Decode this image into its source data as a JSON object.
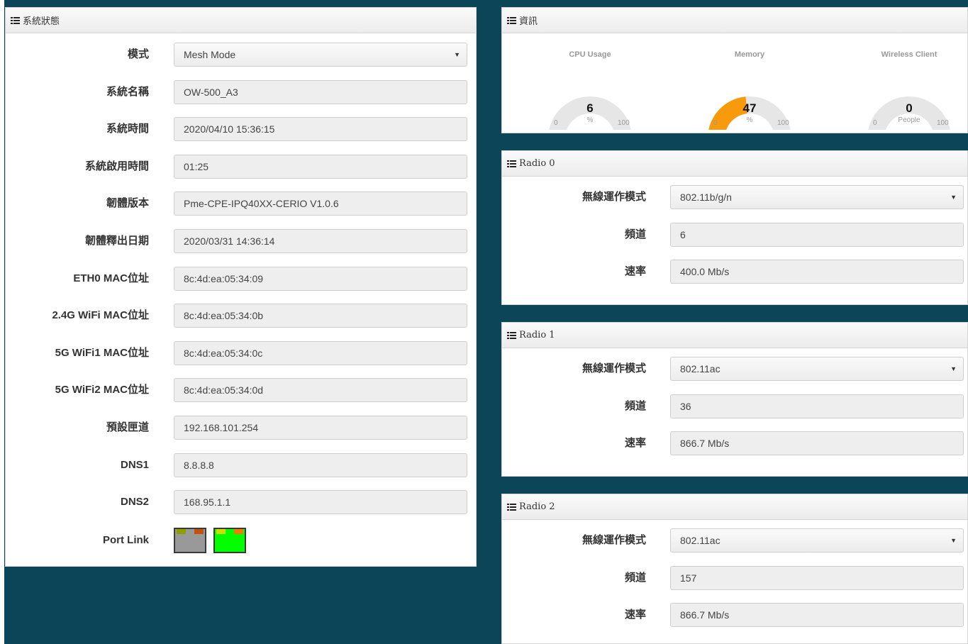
{
  "system": {
    "title": "系統狀態",
    "rows": [
      {
        "label": "模式",
        "value": "Mesh Mode",
        "type": "select"
      },
      {
        "label": "系統名稱",
        "value": "OW-500_A3",
        "type": "text"
      },
      {
        "label": "系統時間",
        "value": "2020/04/10 15:36:15",
        "type": "text"
      },
      {
        "label": "系統啟用時間",
        "value": "01:25",
        "type": "text"
      },
      {
        "label": "韌體版本",
        "value": "Pme-CPE-IPQ40XX-CERIO V1.0.6",
        "type": "text"
      },
      {
        "label": "韌體釋出日期",
        "value": "2020/03/31 14:36:14",
        "type": "text"
      },
      {
        "label": "ETH0 MAC位址",
        "value": "8c:4d:ea:05:34:09",
        "type": "text"
      },
      {
        "label": "2.4G WiFi MAC位址",
        "value": "8c:4d:ea:05:34:0b",
        "type": "text"
      },
      {
        "label": "5G WiFi1 MAC位址",
        "value": "8c:4d:ea:05:34:0c",
        "type": "text"
      },
      {
        "label": "5G WiFi2 MAC位址",
        "value": "8c:4d:ea:05:34:0d",
        "type": "text"
      },
      {
        "label": "預設匣道",
        "value": "192.168.101.254",
        "type": "text"
      },
      {
        "label": "DNS1",
        "value": "8.8.8.8",
        "type": "text"
      },
      {
        "label": "DNS2",
        "value": "168.95.1.1",
        "type": "text"
      }
    ],
    "port_link_label": "Port Link",
    "ports": [
      {
        "status": "inactive",
        "color": "#999999"
      },
      {
        "status": "active",
        "color": "#00ff00"
      }
    ]
  },
  "info": {
    "title": "資訊",
    "gauges": [
      {
        "title": "CPU Usage",
        "value": 6,
        "unit": "%",
        "min": "0",
        "max": "100",
        "color": "#8fc97a"
      },
      {
        "title": "Memory",
        "value": 47,
        "unit": "%",
        "min": "0",
        "max": "100",
        "color": "#f79b0c"
      },
      {
        "title": "Wireless Client",
        "value": 0,
        "unit": "People",
        "min": "0",
        "max": "100",
        "color": "#8fc97a"
      }
    ]
  },
  "radios": [
    {
      "title": "Radio 0",
      "mode_label": "無線運作模式",
      "mode": "802.11b/g/n",
      "channel_label": "頻道",
      "channel": "6",
      "rate_label": "速率",
      "rate": "400.0 Mb/s"
    },
    {
      "title": "Radio 1",
      "mode_label": "無線運作模式",
      "mode": "802.11ac",
      "channel_label": "頻道",
      "channel": "36",
      "rate_label": "速率",
      "rate": "866.7 Mb/s"
    },
    {
      "title": "Radio 2",
      "mode_label": "無線運作模式",
      "mode": "802.11ac",
      "channel_label": "頻道",
      "channel": "157",
      "rate_label": "速率",
      "rate": "866.7 Mb/s"
    }
  ],
  "icons": {
    "panel_header": "list-icon",
    "select_caret": "caret-down-icon"
  },
  "colors": {
    "background": "#0c4458",
    "field": "#eeeeee",
    "gauge_track": "#e6e6e6"
  }
}
